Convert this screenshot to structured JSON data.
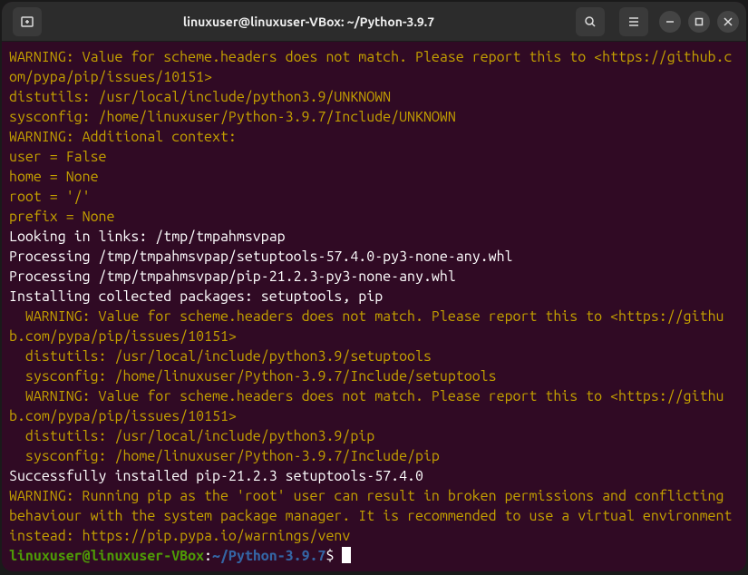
{
  "titlebar": {
    "title": "linuxuser@linuxuser-VBox: ~/Python-3.9.7"
  },
  "output": {
    "l1": "WARNING: Value for scheme.headers does not match. Please report this to <https://github.com/pypa/pip/issues/10151>",
    "l2": "distutils: /usr/local/include/python3.9/UNKNOWN",
    "l3": "sysconfig: /home/linuxuser/Python-3.9.7/Include/UNKNOWN",
    "l4": "WARNING: Additional context:",
    "l5": "user = False",
    "l6": "home = None",
    "l7": "root = '/'",
    "l8": "prefix = None",
    "l9": "Looking in links: /tmp/tmpahmsvpap",
    "l10": "Processing /tmp/tmpahmsvpap/setuptools-57.4.0-py3-none-any.whl",
    "l11": "Processing /tmp/tmpahmsvpap/pip-21.2.3-py3-none-any.whl",
    "l12": "Installing collected packages: setuptools, pip",
    "l13": "  WARNING: Value for scheme.headers does not match. Please report this to <https://github.com/pypa/pip/issues/10151>",
    "l14": "  distutils: /usr/local/include/python3.9/setuptools",
    "l15": "  sysconfig: /home/linuxuser/Python-3.9.7/Include/setuptools",
    "l16": "  WARNING: Value for scheme.headers does not match. Please report this to <https://github.com/pypa/pip/issues/10151>",
    "l17": "  distutils: /usr/local/include/python3.9/pip",
    "l18": "  sysconfig: /home/linuxuser/Python-3.9.7/Include/pip",
    "l19": "Successfully installed pip-21.2.3 setuptools-57.4.0",
    "l20": "WARNING: Running pip as the 'root' user can result in broken permissions and conflicting behaviour with the system package manager. It is recommended to use a virtual environment instead: https://pip.pypa.io/warnings/venv"
  },
  "prompt": {
    "user_host": "linuxuser@linuxuser-VBox",
    "colon": ":",
    "path": "~/Python-3.9.7",
    "dollar": "$ "
  }
}
